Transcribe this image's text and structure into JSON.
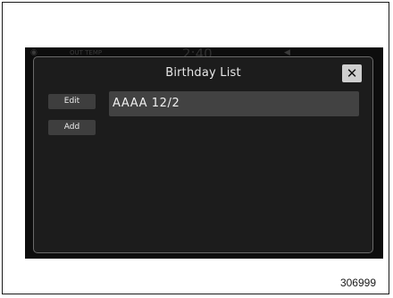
{
  "status_bar": {
    "trip_label": "OUT TEMP",
    "clock": "2:40"
  },
  "dialog": {
    "title": "Birthday List",
    "close_symbol": "✕",
    "buttons": {
      "edit_label": "Edit",
      "add_label": "Add"
    },
    "entries": [
      {
        "text": "AAAA 12/2"
      }
    ]
  },
  "figure_id": "306999",
  "icons": [
    "signal-icon",
    "volume-icon",
    "close-icon"
  ],
  "colors": {
    "screen_bg": "#0d0d0d",
    "dialog_bg": "#1c1c1c",
    "button_bg": "#3e3e3e",
    "row_bg": "#424242"
  }
}
